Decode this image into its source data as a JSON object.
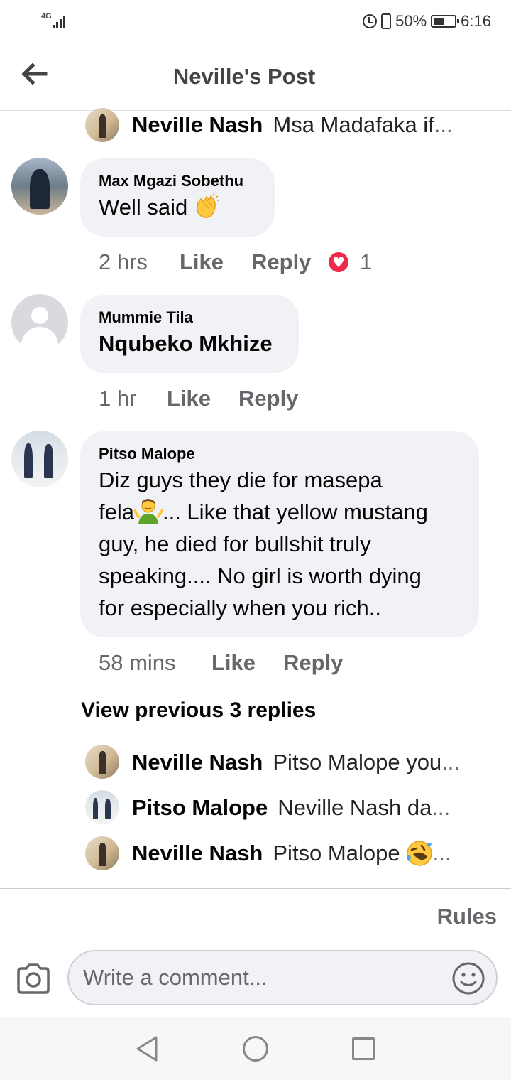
{
  "status_bar": {
    "network": "4G",
    "battery": "50%",
    "time": "6:16"
  },
  "header": {
    "title": "Neville's Post"
  },
  "top_reply": {
    "author": "Neville Nash",
    "preview": "Msa Madafaka if",
    "ellipsis": "..."
  },
  "comments": [
    {
      "author": "Max Mgazi Sobethu",
      "text": "Well said",
      "emoji": "clapping-hands",
      "time": "2 hrs",
      "like": "Like",
      "reply": "Reply",
      "reaction_count": "1"
    },
    {
      "author": "Mummie Tila",
      "text": "Nqubeko Mkhize",
      "time": "1 hr",
      "like": "Like",
      "reply": "Reply"
    },
    {
      "author": "Pitso Malope",
      "text_line1": "Diz guys they die for masepa",
      "text_line2_a": "fela",
      "text_line2_b": "... Like that yellow mustang",
      "text_line3": "guy, he died for bullshit truly",
      "text_line4": "speaking.... No girl is worth dying",
      "text_line5": "for especially when you rich..",
      "emoji": "person-shrugging",
      "time": "58 mins",
      "like": "Like",
      "reply": "Reply"
    }
  ],
  "view_previous": "View previous 3 replies",
  "replies": [
    {
      "author": "Neville Nash",
      "preview": "Pitso Malope you",
      "ellipsis": "..."
    },
    {
      "author": "Pitso Malope",
      "preview": "Neville Nash da",
      "ellipsis": "..."
    },
    {
      "author": "Neville Nash",
      "preview": "Pitso Malope",
      "emoji": "rolling-on-floor-laughing",
      "ellipsis": "..."
    }
  ],
  "footer": {
    "rules": "Rules",
    "comment_placeholder": "Write a comment..."
  },
  "colors": {
    "bubble": "#f0f2f5",
    "meta_text": "#65676b",
    "reaction_heart": "#f02849"
  }
}
